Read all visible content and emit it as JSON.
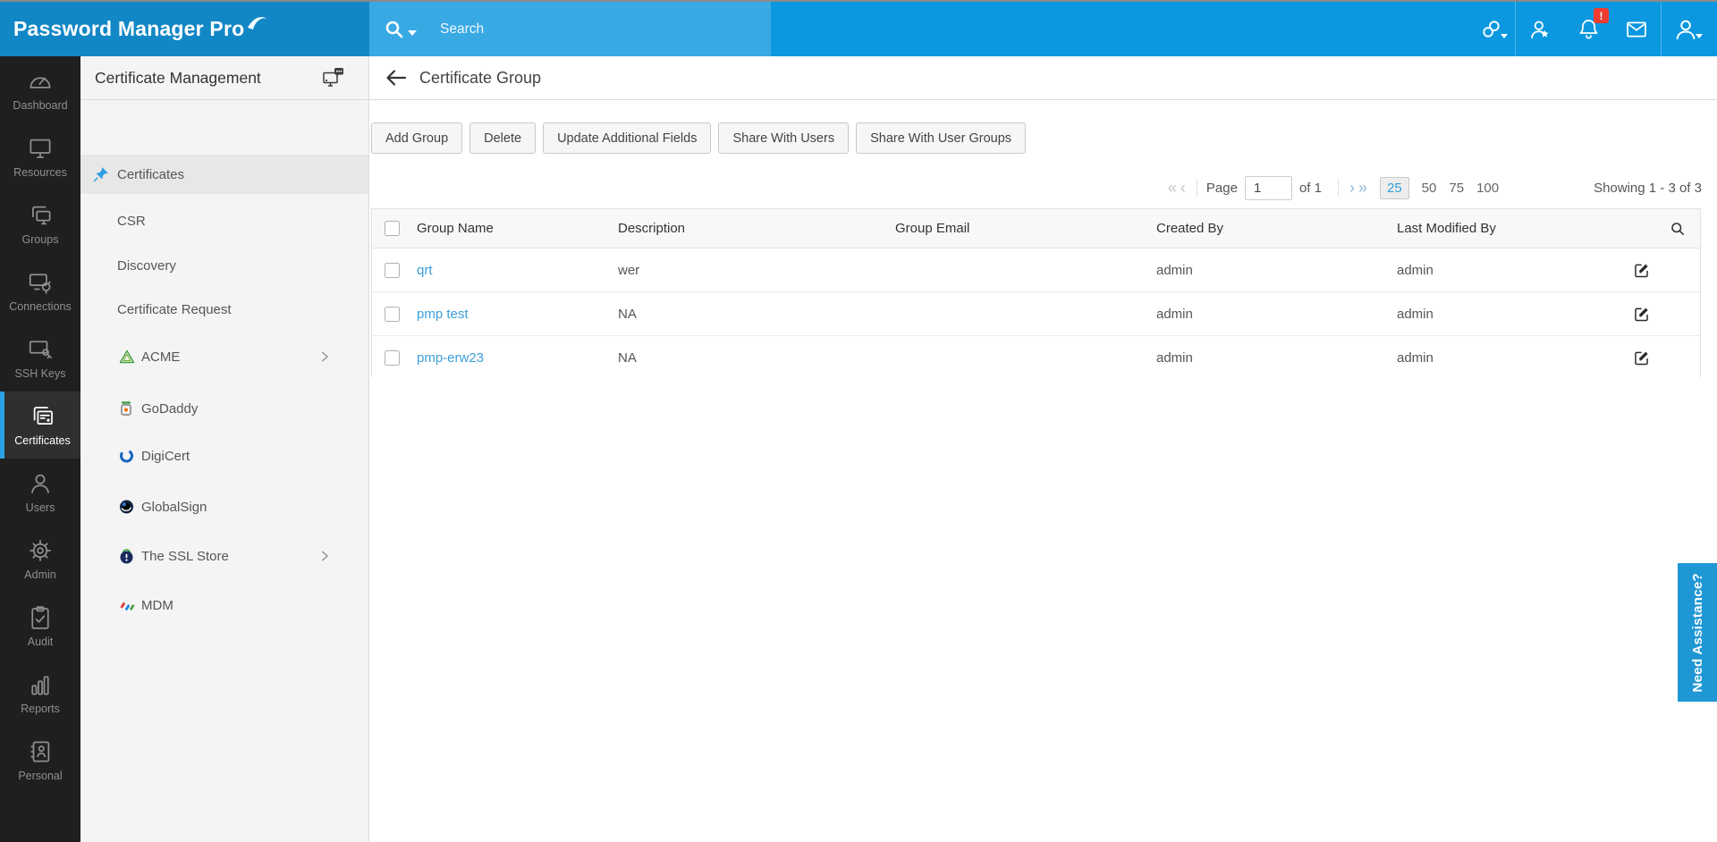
{
  "colors": {
    "topbar_left": "#1287c6",
    "topbar_search": "#39a9e4",
    "topbar_right": "#0b98e1",
    "accent_blue": "#2d9fe0",
    "badge_red": "#ef3b30",
    "sidebar_bg": "#1f1f1f",
    "link_blue": "#3b9fd8",
    "assist_bg": "#1f97d4"
  },
  "topbar": {
    "logo_text": "Password Manager Pro",
    "search_placeholder": "Search",
    "notification_badge": "!",
    "icons": [
      "link-icon",
      "user-star-icon",
      "notification-bell-icon",
      "mail-icon",
      "user-icon"
    ]
  },
  "sidebar": {
    "items": [
      {
        "label": "Dashboard",
        "icon": "dashboard-icon",
        "active": false
      },
      {
        "label": "Resources",
        "icon": "resources-icon",
        "active": false
      },
      {
        "label": "Groups",
        "icon": "groups-icon",
        "active": false
      },
      {
        "label": "Connections",
        "icon": "connections-icon",
        "active": false
      },
      {
        "label": "SSH Keys",
        "icon": "ssh-keys-icon",
        "active": false
      },
      {
        "label": "Certificates",
        "icon": "certificates-icon",
        "active": true
      },
      {
        "label": "Users",
        "icon": "users-icon",
        "active": false
      },
      {
        "label": "Admin",
        "icon": "admin-gear-icon",
        "active": false
      },
      {
        "label": "Audit",
        "icon": "audit-icon",
        "active": false
      },
      {
        "label": "Reports",
        "icon": "reports-icon",
        "active": false
      },
      {
        "label": "Personal",
        "icon": "personal-icon",
        "active": false
      }
    ]
  },
  "panel": {
    "title": "Certificate Management",
    "header_icon": "screen-chat-icon",
    "items": [
      {
        "label": "Certificates",
        "icon": "pin-icon",
        "active": true,
        "chevron": false
      },
      {
        "label": "CSR",
        "icon": "",
        "active": false,
        "chevron": false
      },
      {
        "label": "Discovery",
        "icon": "",
        "active": false,
        "chevron": false
      },
      {
        "label": "Certificate Request",
        "icon": "",
        "active": false,
        "chevron": false
      },
      {
        "label": "ACME",
        "icon": "acme-icon",
        "active": false,
        "chevron": true
      },
      {
        "label": "GoDaddy",
        "icon": "godaddy-icon",
        "active": false,
        "chevron": false
      },
      {
        "label": "DigiCert",
        "icon": "digicert-icon",
        "active": false,
        "chevron": false
      },
      {
        "label": "GlobalSign",
        "icon": "globalsign-icon",
        "active": false,
        "chevron": false
      },
      {
        "label": "The SSL Store",
        "icon": "sslstore-icon",
        "active": false,
        "chevron": true
      },
      {
        "label": "MDM",
        "icon": "mdm-icon",
        "active": false,
        "chevron": false
      }
    ]
  },
  "page": {
    "title": "Certificate Group",
    "toolbar": [
      "Add Group",
      "Delete",
      "Update Additional Fields",
      "Share With Users",
      "Share With User Groups"
    ],
    "pagination": {
      "page_label": "Page",
      "page_value": "1",
      "of_label": "of 1",
      "page_sizes": [
        "25",
        "50",
        "75",
        "100"
      ],
      "active_size": "25",
      "showing": "Showing 1 - 3 of 3"
    },
    "table": {
      "columns": [
        "Group Name",
        "Description",
        "Group Email",
        "Created By",
        "Last Modified By"
      ],
      "rows": [
        {
          "name": "qrt",
          "description": "wer",
          "email": "",
          "created_by": "admin",
          "last_modified_by": "admin"
        },
        {
          "name": "pmp test",
          "description": "NA",
          "email": "",
          "created_by": "admin",
          "last_modified_by": "admin"
        },
        {
          "name": "pmp-erw23",
          "description": "NA",
          "email": "",
          "created_by": "admin",
          "last_modified_by": "admin"
        }
      ]
    }
  },
  "assist_tab": "Need Assistance?"
}
